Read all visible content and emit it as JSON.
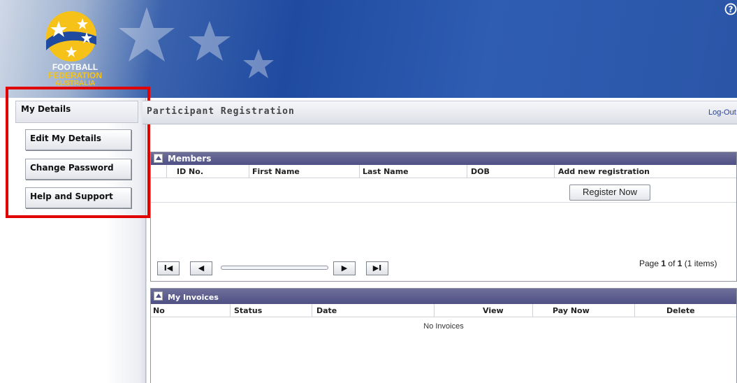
{
  "header": {
    "logo_line1": "FOOTBALL",
    "logo_line2": "FEDERATION",
    "logo_line3": "AUSTRALIA",
    "help_icon": "help-icon"
  },
  "sidebar": {
    "title": "My Details",
    "items": [
      {
        "label": "Edit My Details"
      },
      {
        "label": "Change Password"
      },
      {
        "label": "Help and Support"
      }
    ]
  },
  "main": {
    "page_title": "Participant Registration",
    "logout_label": "Log-Out",
    "members": {
      "title": "Members",
      "columns": [
        "ID No.",
        "First Name",
        "Last Name",
        "DOB",
        "Add new registration"
      ],
      "register_label": "Register Now",
      "pager": {
        "first": "I◀",
        "prev": "◀",
        "next": "▶",
        "last": "▶I",
        "page_prefix": "Page",
        "page": "1",
        "of": "of",
        "total": "1",
        "items": "(1 items)"
      }
    },
    "invoices": {
      "title": "My Invoices",
      "columns": [
        "No",
        "Status",
        "Date",
        "View",
        "Pay Now",
        "Delete"
      ],
      "empty_text": "No Invoices"
    }
  },
  "colors": {
    "header_blue": "#1f4aa0",
    "panel_header": "#4f5085",
    "highlight_red": "#e00000",
    "link_blue": "#1f3fa6"
  }
}
